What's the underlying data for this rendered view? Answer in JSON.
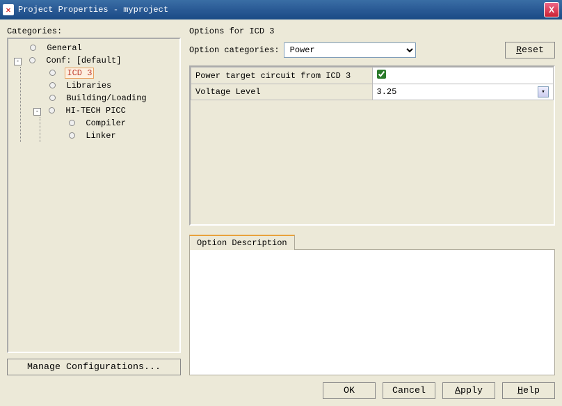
{
  "titlebar": {
    "title": "Project Properties - myproject",
    "closeGlyph": "X"
  },
  "categoriesLabel": "Categories:",
  "tree": {
    "general": "General",
    "conf": "Conf: [default]",
    "icd3": "ICD 3",
    "libraries": "Libraries",
    "buildingLoading": "Building/Loading",
    "hitech": "HI-TECH PICC",
    "compiler": "Compiler",
    "linker": "Linker"
  },
  "manageBtn": "Manage Configurations...",
  "rightPanel": {
    "optionsFor": "Options for ICD 3",
    "optionCategoriesLabel": "Option categories:",
    "categoryValue": "Power",
    "resetLabel": "Reset",
    "rows": {
      "powerTargetLabel": "Power target circuit from ICD 3",
      "powerTargetChecked": true,
      "voltageLabel": "Voltage Level",
      "voltageValue": "3.25"
    },
    "descTab": "Option Description"
  },
  "buttons": {
    "ok": "OK",
    "cancel": "Cancel",
    "apply": "Apply",
    "help": "Help"
  }
}
